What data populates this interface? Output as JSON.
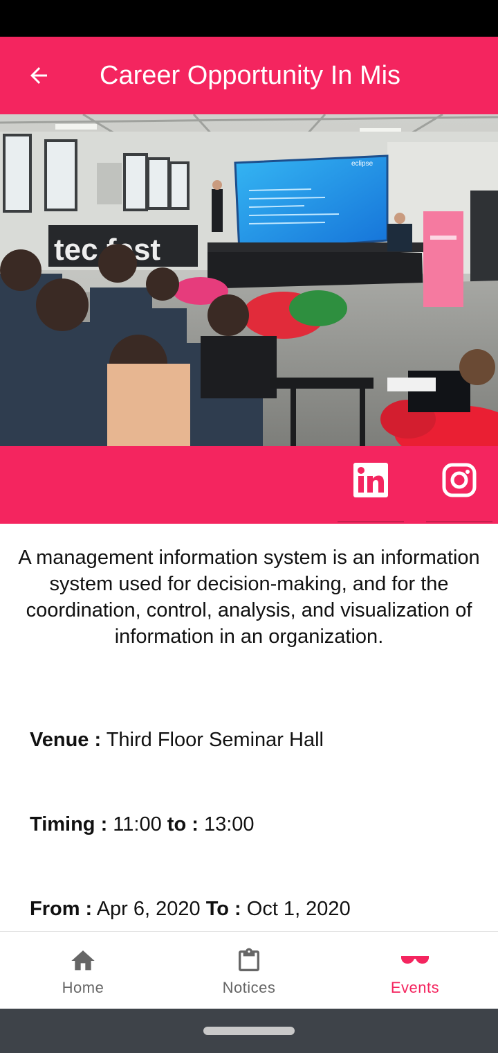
{
  "app_bar": {
    "title": "Career Opportunity In Mis",
    "color": "#f4255f"
  },
  "hero": {
    "banner_text": "tec fest",
    "screen_brand": "eclipse"
  },
  "social": {
    "linkedin_icon": "linkedin-icon",
    "instagram_icon": "instagram-icon"
  },
  "event": {
    "description": "A management information system is an information system used for decision-making, and for the coordination, control, analysis, and visualization of information in an organization.",
    "venue_label": "Venue :",
    "venue": "Third Floor Seminar Hall",
    "timing_label": "Timing :",
    "start_time": "11:00",
    "time_to_label": "to :",
    "end_time": "13:00",
    "from_label": "From :",
    "start_date": "Apr 6, 2020",
    "date_to_label": "To :",
    "end_date": "Oct 1, 2020"
  },
  "nav": {
    "items": [
      {
        "label": "Home",
        "icon": "home-icon"
      },
      {
        "label": "Notices",
        "icon": "clipboard-icon"
      },
      {
        "label": "Events",
        "icon": "sunglasses-icon"
      }
    ],
    "active_index": 2,
    "active_color": "#f4255f",
    "inactive_color": "#666666"
  }
}
